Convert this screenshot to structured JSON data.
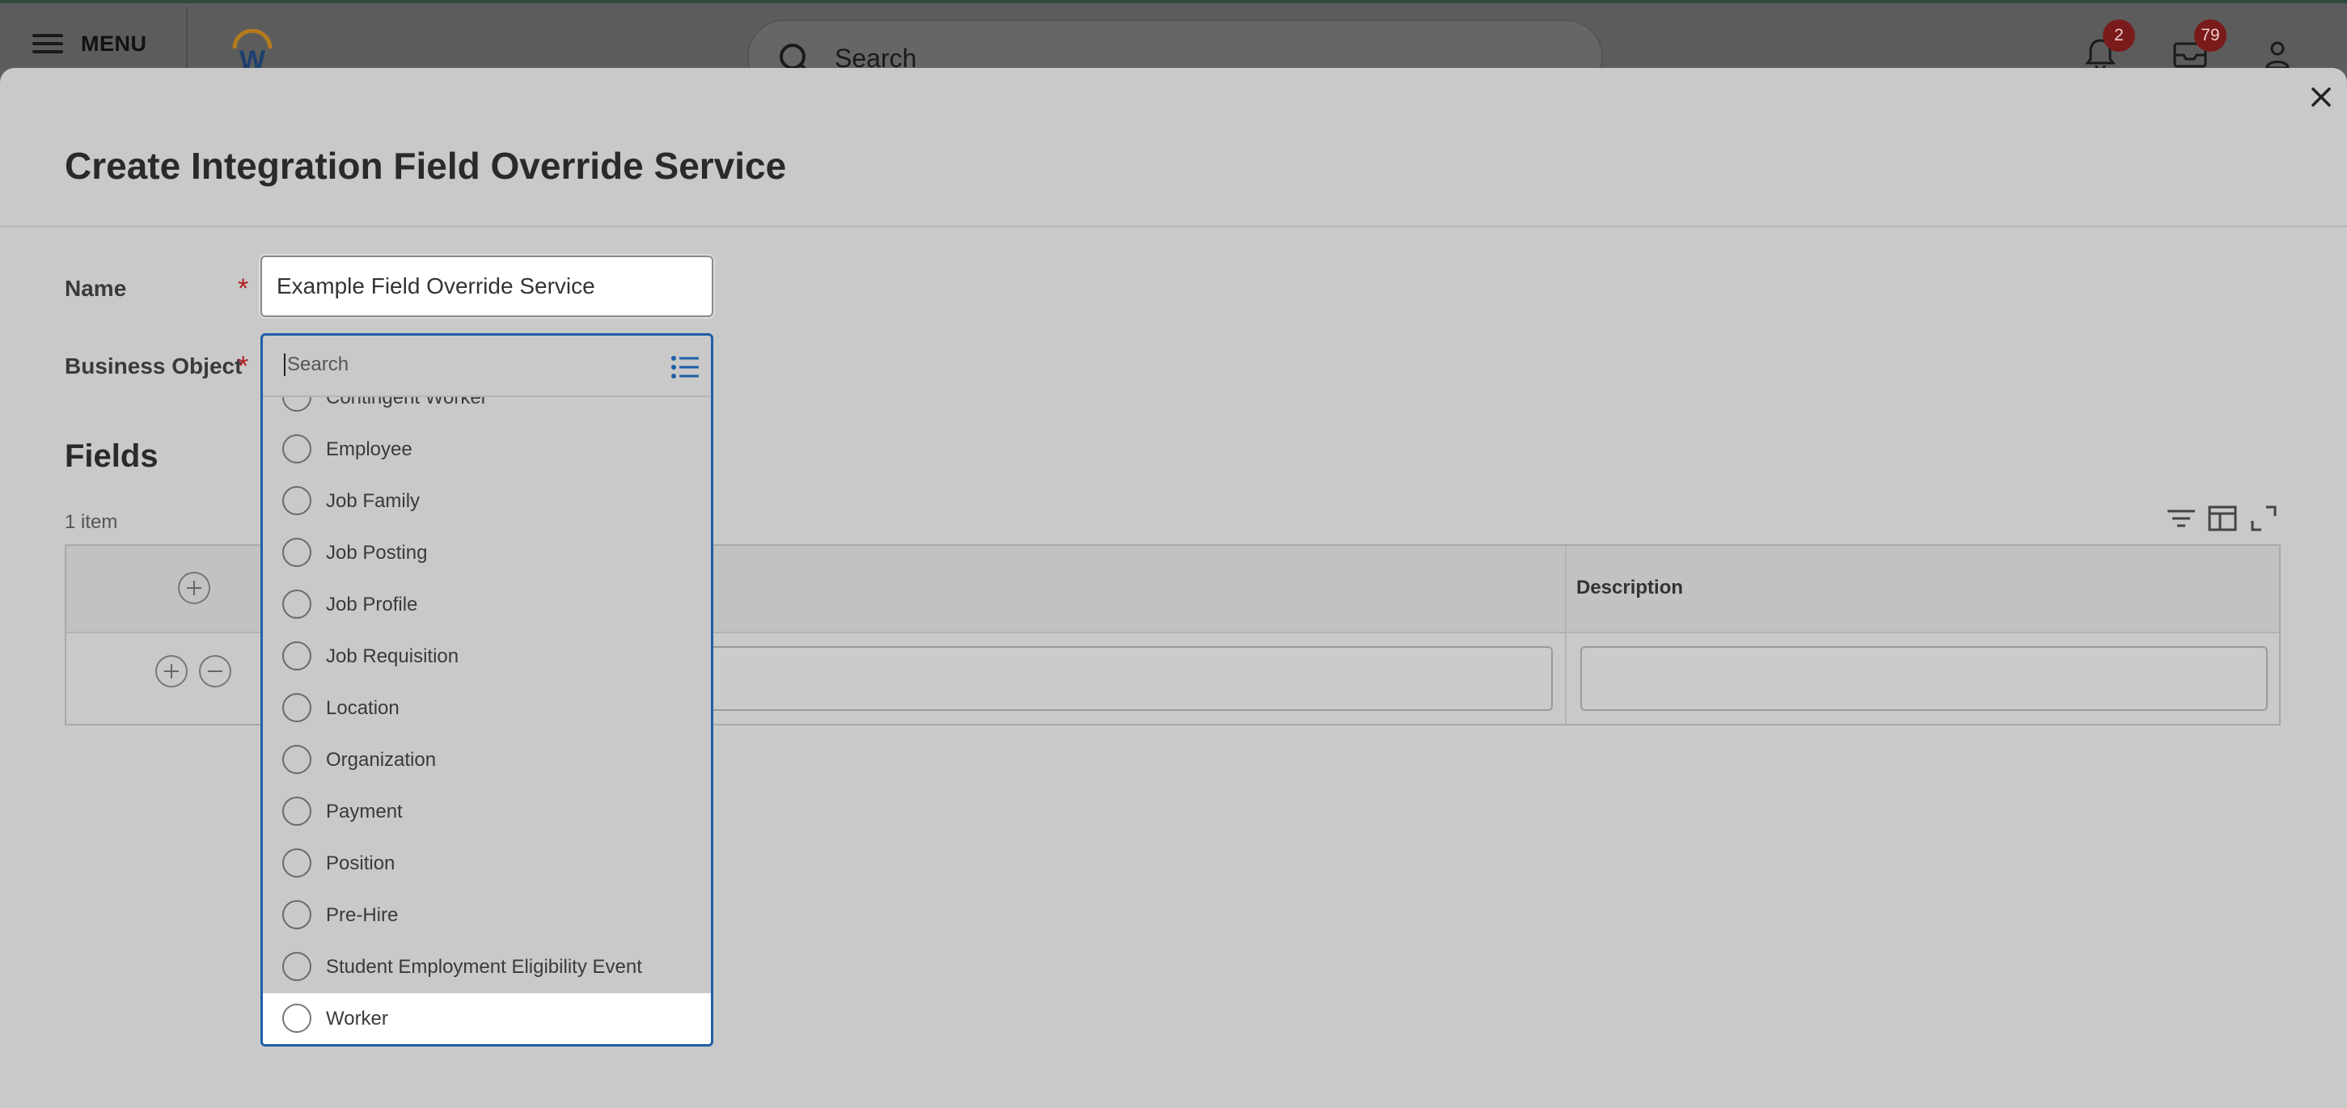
{
  "topbar": {
    "menu_label": "MENU",
    "search_placeholder": "Search",
    "notifications_count": "2",
    "inbox_count": "79"
  },
  "modal": {
    "title": "Create Integration Field Override Service",
    "name_label": "Name",
    "name_value": "Example Field Override Service",
    "business_object_label": "Business Object",
    "required_mark": "*",
    "fields_title": "Fields",
    "item_count": "1 item",
    "grid": {
      "description_header": "Description"
    }
  },
  "dropdown": {
    "search_placeholder": "Search",
    "options": [
      "Contingent Worker",
      "Employee",
      "Job Family",
      "Job Posting",
      "Job Profile",
      "Job Requisition",
      "Location",
      "Organization",
      "Payment",
      "Position",
      "Pre-Hire",
      "Student Employment Eligibility Event",
      "Worker"
    ],
    "highlighted": "Worker"
  },
  "colors": {
    "accent": "#1f5fa8",
    "required": "#b02020",
    "badge": "#7a1b1b"
  }
}
